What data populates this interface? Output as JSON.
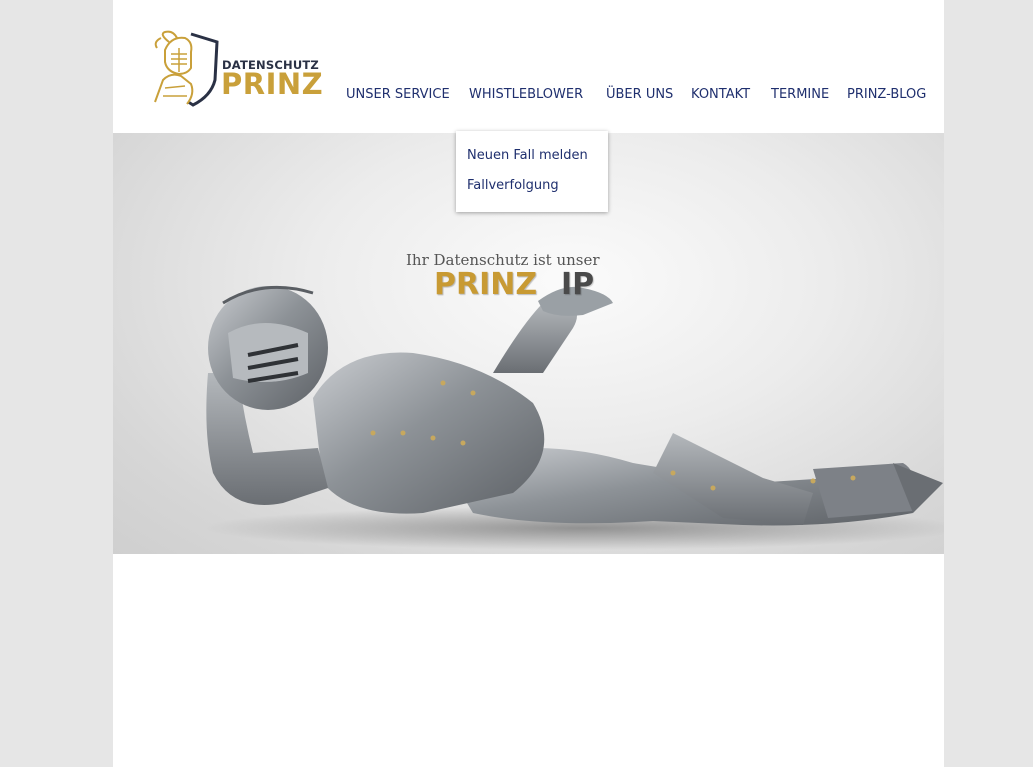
{
  "brand": {
    "small_text": "DATENSCHUTZ",
    "big_text": "PRINZ",
    "accent_color": "#c9a03a",
    "navy_color": "#1f2f6e"
  },
  "nav": {
    "items": [
      {
        "label": "UNSER SERVICE"
      },
      {
        "label": "WHISTLEBLOWER"
      },
      {
        "label": "ÜBER UNS"
      },
      {
        "label": "KONTAKT"
      },
      {
        "label": "TERMINE"
      },
      {
        "label": "PRINZ-BLOG"
      }
    ],
    "open_menu": "WHISTLEBLOWER"
  },
  "dropdown": {
    "items": [
      {
        "label": "Neuen Fall melden"
      },
      {
        "label": "Fallverfolgung"
      }
    ]
  },
  "hero": {
    "tagline": "Ihr Datenschutz ist unser",
    "prinz": "PRINZ",
    "ip": "IP",
    "image_subject": "reclining-knight-armor"
  }
}
